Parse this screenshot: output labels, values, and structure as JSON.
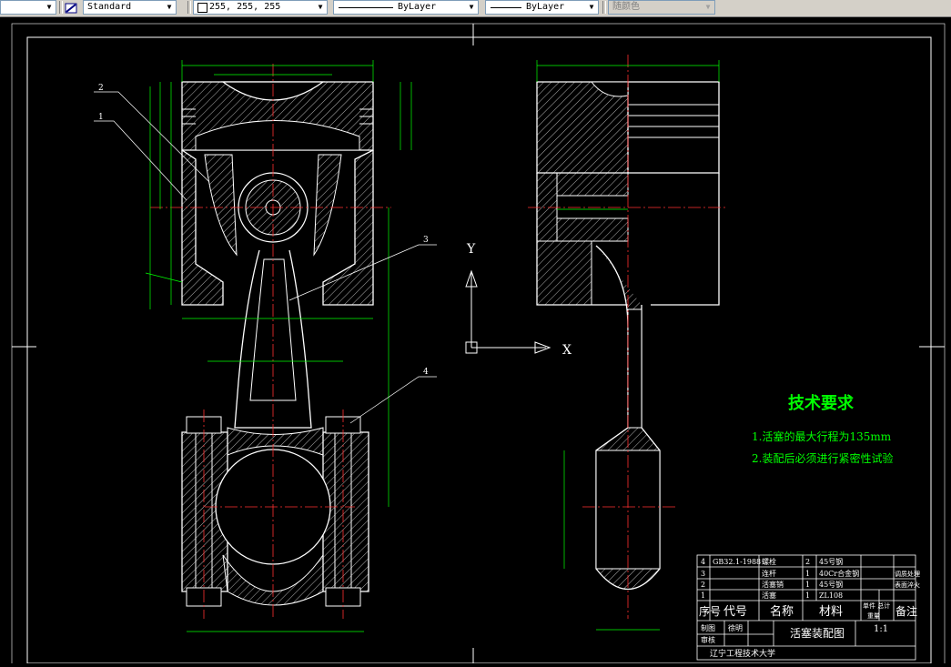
{
  "toolbar": {
    "dim_style": "Standard",
    "color_value": "255, 255, 255",
    "linetype": "ByLayer",
    "lineweight": "ByLayer",
    "plot_style": "随颜色"
  },
  "drawing": {
    "tech_title": "技术要求",
    "req1": "1.活塞的最大行程为135mm",
    "req2": "2.装配后必须进行紧密性试验",
    "balloons": [
      "1",
      "2",
      "3",
      "4"
    ],
    "ucs_y": "Y",
    "ucs_x": "X"
  },
  "titleblock": {
    "rows": [
      {
        "no": "4",
        "code": "GB32.1-1988",
        "name": "螺栓",
        "qty": "2",
        "mat": "45号钢",
        "note": ""
      },
      {
        "no": "3",
        "code": "",
        "name": "连杆",
        "qty": "1",
        "mat": "40Cr合金钢",
        "note": "调质处理"
      },
      {
        "no": "2",
        "code": "",
        "name": "活塞销",
        "qty": "1",
        "mat": "45号钢",
        "note": "表面淬火"
      },
      {
        "no": "1",
        "code": "",
        "name": "活塞",
        "qty": "1",
        "mat": "ZL108",
        "note": ""
      }
    ],
    "hdr_no": "序号",
    "hdr_code": "代号",
    "hdr_name": "名称",
    "hdr_mat": "材料",
    "hdr_wt": "单件 总计",
    "hdr_wt2": "重量",
    "hdr_note": "备注",
    "draw_label": "制图",
    "check_label": "审核",
    "designer": "徐明",
    "title": "活塞装配图",
    "scale": "1:1",
    "school": "辽宁工程技术大学"
  }
}
